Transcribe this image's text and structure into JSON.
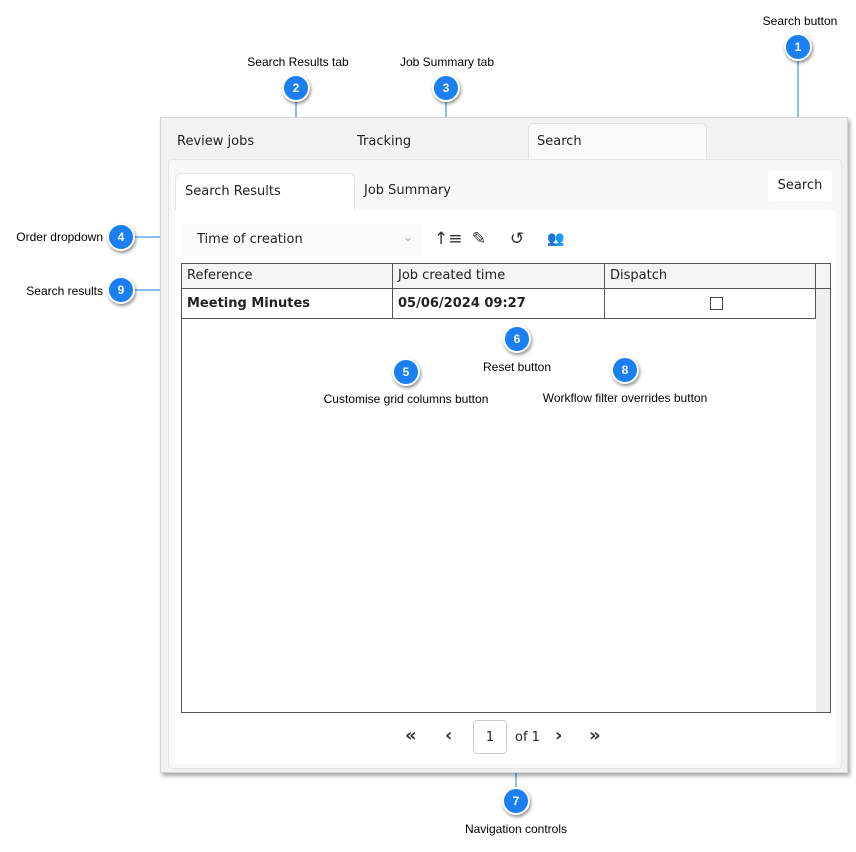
{
  "callouts": [
    {
      "n": "1",
      "label": "Search button"
    },
    {
      "n": "2",
      "label": "Search Results tab"
    },
    {
      "n": "3",
      "label": "Job Summary tab"
    },
    {
      "n": "4",
      "label": "Order dropdown"
    },
    {
      "n": "5",
      "label": "Customise grid columns button"
    },
    {
      "n": "6",
      "label": "Reset button"
    },
    {
      "n": "7",
      "label": "Navigation controls"
    },
    {
      "n": "8",
      "label": "Workflow filter overrides button"
    },
    {
      "n": "9",
      "label": "Search results"
    }
  ],
  "top_tabs": [
    "Review jobs",
    "Tracking",
    "Search"
  ],
  "sub_tabs": [
    "Search Results",
    "Job Summary"
  ],
  "search_button": "Search",
  "order_dropdown": {
    "value": "Time of creation"
  },
  "toolbar_icons": [
    "sort-ascending-icon",
    "edit-columns-icon",
    "reset-icon",
    "users-gear-icon"
  ],
  "grid": {
    "columns": [
      "Reference",
      "Job created time",
      "Dispatch"
    ],
    "rows": [
      {
        "reference": "Meeting Minutes",
        "created": "05/06/2024 09:27",
        "dispatch": false
      }
    ]
  },
  "pagination": {
    "page": "1",
    "of": "of 1"
  },
  "accent": "#1a7ff0"
}
